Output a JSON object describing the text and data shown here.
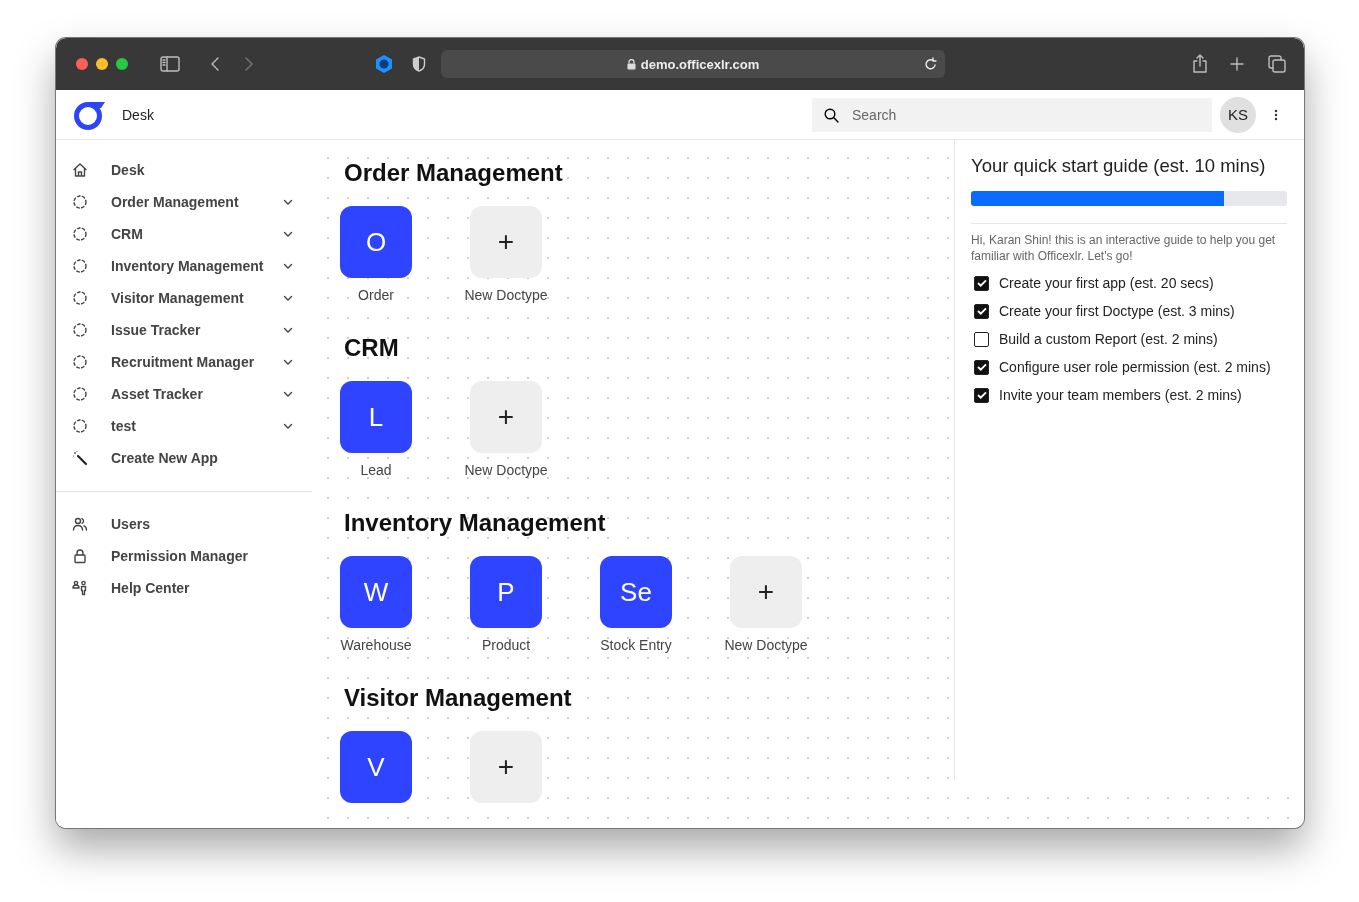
{
  "browser": {
    "url": "demo.officexlr.com"
  },
  "header": {
    "title": "Desk",
    "search": {
      "placeholder": "Search"
    },
    "avatar": "KS"
  },
  "sidebar": {
    "items": [
      {
        "kind": "home",
        "label": "Desk"
      },
      {
        "kind": "app",
        "label": "Order Management"
      },
      {
        "kind": "app",
        "label": "CRM"
      },
      {
        "kind": "app",
        "label": "Inventory Management"
      },
      {
        "kind": "app",
        "label": "Visitor Management"
      },
      {
        "kind": "app",
        "label": "Issue Tracker"
      },
      {
        "kind": "app",
        "label": "Recruitment Manager"
      },
      {
        "kind": "app",
        "label": "Asset Tracker"
      },
      {
        "kind": "app",
        "label": "test"
      },
      {
        "kind": "wand",
        "label": "Create New App"
      }
    ],
    "bottom_items": [
      {
        "kind": "users",
        "label": "Users"
      },
      {
        "kind": "lock",
        "label": "Permission Manager"
      },
      {
        "kind": "help",
        "label": "Help Center"
      }
    ]
  },
  "sections": [
    {
      "title": "Order Management",
      "tiles": [
        {
          "kind": "app",
          "letter": "O",
          "label": "Order"
        },
        {
          "kind": "add",
          "letter": "+",
          "label": "New Doctype"
        }
      ]
    },
    {
      "title": "CRM",
      "tiles": [
        {
          "kind": "app",
          "letter": "L",
          "label": "Lead"
        },
        {
          "kind": "add",
          "letter": "+",
          "label": "New Doctype"
        }
      ]
    },
    {
      "title": "Inventory Management",
      "tiles": [
        {
          "kind": "app",
          "letter": "W",
          "label": "Warehouse"
        },
        {
          "kind": "app",
          "letter": "P",
          "label": "Product"
        },
        {
          "kind": "app",
          "letter": "Se",
          "label": "Stock Entry"
        },
        {
          "kind": "add",
          "letter": "+",
          "label": "New Doctype"
        }
      ]
    },
    {
      "title": "Visitor Management",
      "tiles": [
        {
          "kind": "app",
          "letter": "V"
        },
        {
          "kind": "add",
          "letter": "+"
        }
      ]
    }
  ],
  "guide": {
    "title": "Your quick start guide (est. 10 mins)",
    "level": 0.8,
    "intro": "Hi, Karan Shin! this is an interactive guide to help you get familiar with Officexlr. Let's go!",
    "tasks": [
      {
        "label": "Create your first app (est. 20 secs)",
        "checked": true
      },
      {
        "label": "Create your first Doctype (est. 3 mins)",
        "checked": true
      },
      {
        "label": "Build a custom Report (est. 2 mins)",
        "checked": false
      },
      {
        "label": "Configure user role permission (est. 2 mins)",
        "checked": true
      },
      {
        "label": "Invite your team members (est. 2 mins)",
        "checked": true
      }
    ]
  }
}
